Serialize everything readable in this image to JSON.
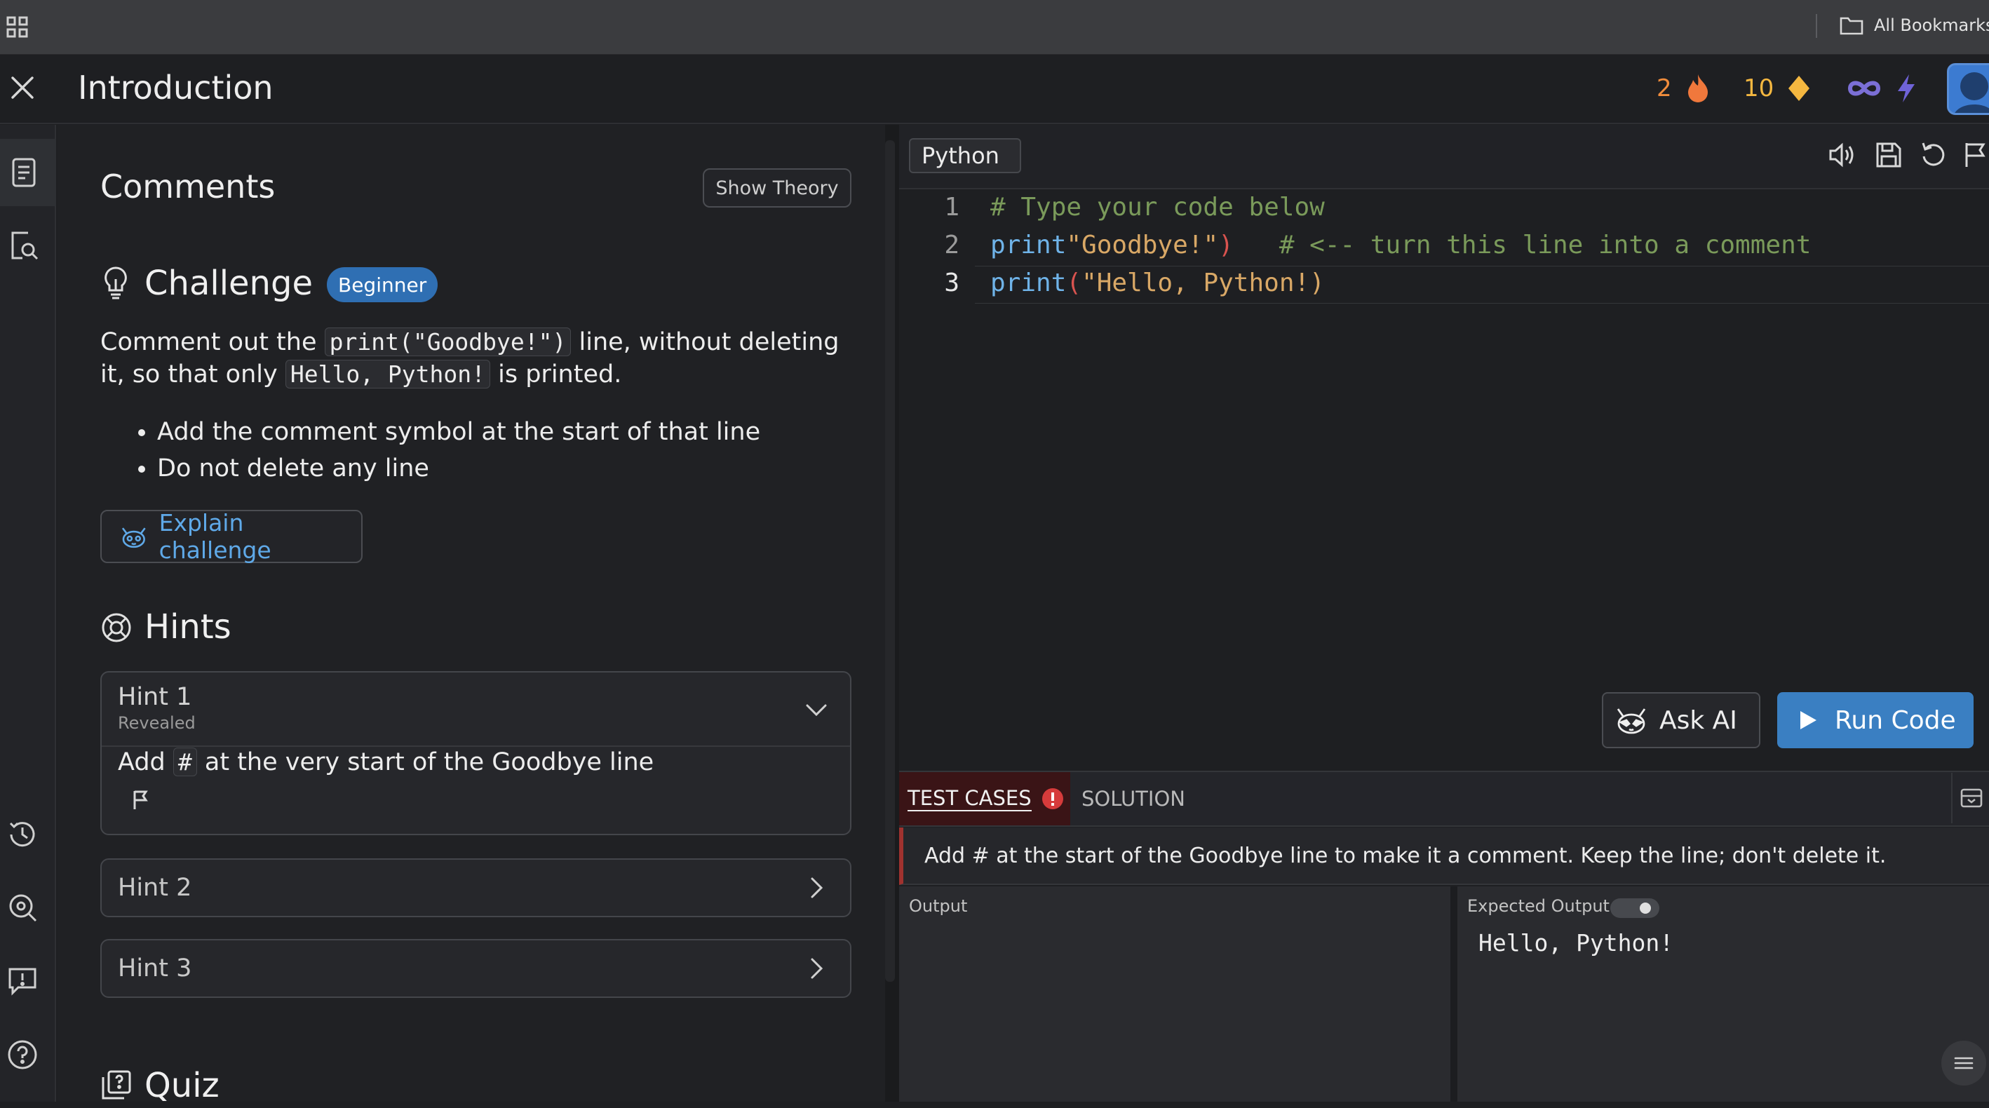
{
  "browser": {
    "bookmarks_label": "All Bookmarks"
  },
  "header": {
    "title": "Introduction",
    "streak": "2",
    "gems": "10"
  },
  "lesson": {
    "section_title": "Comments",
    "show_theory_label": "Show Theory",
    "challenge": {
      "title": "Challenge",
      "level": "Beginner",
      "desc_part1": "Comment out the ",
      "desc_code1": "print(\"Goodbye!\")",
      "desc_part2": " line, without deleting it, so that only ",
      "desc_code2": "Hello, Python!",
      "desc_part3": " is printed.",
      "bullets": [
        "Add the comment symbol at the start of that line",
        "Do not delete any line"
      ],
      "explain_label": "Explain challenge"
    },
    "hints": {
      "title": "Hints",
      "items": [
        {
          "title": "Hint 1",
          "status": "Revealed",
          "text_before": "Add ",
          "text_code": "#",
          "text_after": " at the very start of the Goodbye line"
        },
        {
          "title": "Hint 2"
        },
        {
          "title": "Hint 3"
        }
      ]
    },
    "quiz_title": "Quiz"
  },
  "editor": {
    "language": "Python",
    "lines": [
      {
        "no": "1",
        "comment": "# Type your code below"
      },
      {
        "no": "2",
        "fn": "print",
        "str": "\"Goodbye!\"",
        "paren": ")",
        "comment": "   # <-- turn this line into a comment"
      },
      {
        "no": "3",
        "fn": "print",
        "paren": "(",
        "str": "\"Hello, Python!)"
      }
    ],
    "ask_ai_label": "Ask AI",
    "run_label": "Run Code"
  },
  "tests": {
    "tab_test_cases": "TEST CASES",
    "tab_solution": "SOLUTION",
    "instruction": "Add # at the start of the Goodbye line to make it a comment. Keep the line; don't delete it.",
    "output_label": "Output",
    "expected_label": "Expected Output",
    "expected_value": "Hello, Python!"
  },
  "colors": {
    "accent_blue": "#3a7fc2",
    "streak_orange": "#f08c3c",
    "gem_yellow": "#f4b740",
    "infinity_purple": "#7b6fd6",
    "error_red": "#d63b3b"
  },
  "icons": {
    "header": [
      "close-icon",
      "flame-icon",
      "gem-icon",
      "infinity-icon",
      "bolt-icon"
    ],
    "rail": [
      "lesson-icon",
      "search-doc-icon",
      "history-icon",
      "zoom-icon",
      "feedback-icon",
      "help-icon"
    ],
    "toolbar": [
      "speaker-icon",
      "save-icon",
      "reset-icon",
      "flag-icon"
    ]
  }
}
